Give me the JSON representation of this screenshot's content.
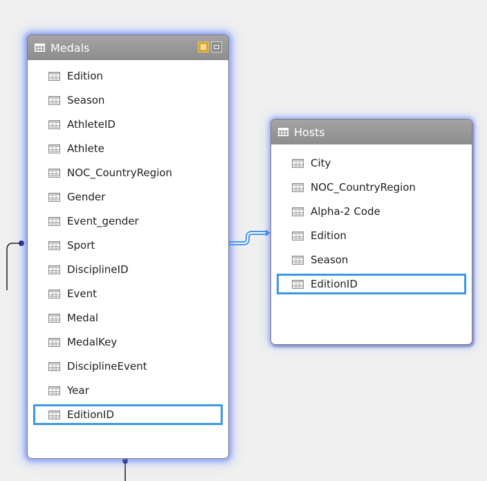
{
  "diagram": {
    "tables": [
      {
        "id": "medals",
        "name": "Medals",
        "selected_field": "EditionID",
        "fields": [
          "Edition",
          "Season",
          "AthleteID",
          "Athlete",
          "NOC_CountryRegion",
          "Gender",
          "Event_gender",
          "Sport",
          "DisciplineID",
          "Event",
          "Medal",
          "MedalKey",
          "DisciplineEvent",
          "Year",
          "EditionID"
        ]
      },
      {
        "id": "hosts",
        "name": "Hosts",
        "selected_field": "EditionID",
        "fields": [
          "City",
          "NOC_CountryRegion",
          "Alpha-2 Code",
          "Edition",
          "Season",
          "EditionID"
        ]
      }
    ],
    "relationships": [
      {
        "from_table": "Medals",
        "from_field": "EditionID",
        "to_table": "Hosts",
        "to_field": "EditionID",
        "highlighted": true
      }
    ],
    "colors": {
      "selection_border": "#3a96e8",
      "header_bg": "#999999",
      "glow": "#5a78ff",
      "relationship_highlight": "#3a8ee8"
    }
  }
}
